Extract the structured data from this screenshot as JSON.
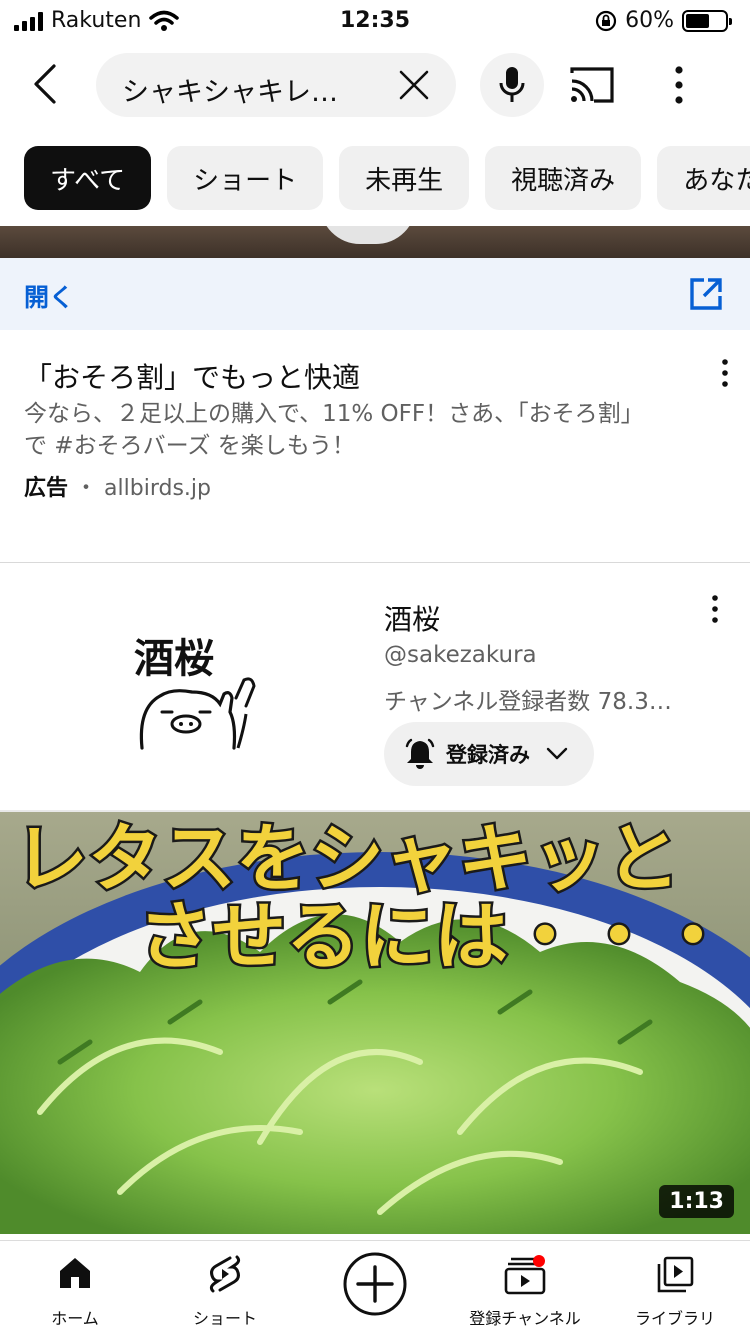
{
  "status_bar": {
    "carrier": "Rakuten",
    "time": "12:35",
    "battery_percent": "60%",
    "battery_level": 0.6
  },
  "header": {
    "search_query": "シャキシャキレ…"
  },
  "chips": [
    "すべて",
    "ショート",
    "未再生",
    "視聴済み",
    "あなた"
  ],
  "ad": {
    "open_label": "開く",
    "title": "「おそろ割」でもっと快適",
    "description": "今なら、２足以上の購入で、11% OFF！さあ、「おそろ割」で #おそろバーズ を楽しもう！",
    "ad_label": "広告",
    "separator": "・",
    "domain": "allbirds.jp"
  },
  "channel": {
    "logo_text": "酒桜",
    "name": "酒桜",
    "handle": "@sakezakura",
    "subscribers": "チャンネル登録者数 78.3…",
    "subscribed_label": "登録済み"
  },
  "video": {
    "overlay_line1": "レタスをシャキッと",
    "overlay_line2": "させるには・・・",
    "duration": "1:13"
  },
  "bottom_nav": {
    "home": "ホーム",
    "shorts": "ショート",
    "subscriptions": "登録チャンネル",
    "library": "ライブラリ"
  },
  "colors": {
    "accent_blue": "#065fd4",
    "notification_red": "#ff0000",
    "overlay_text": "#f2d23c"
  }
}
